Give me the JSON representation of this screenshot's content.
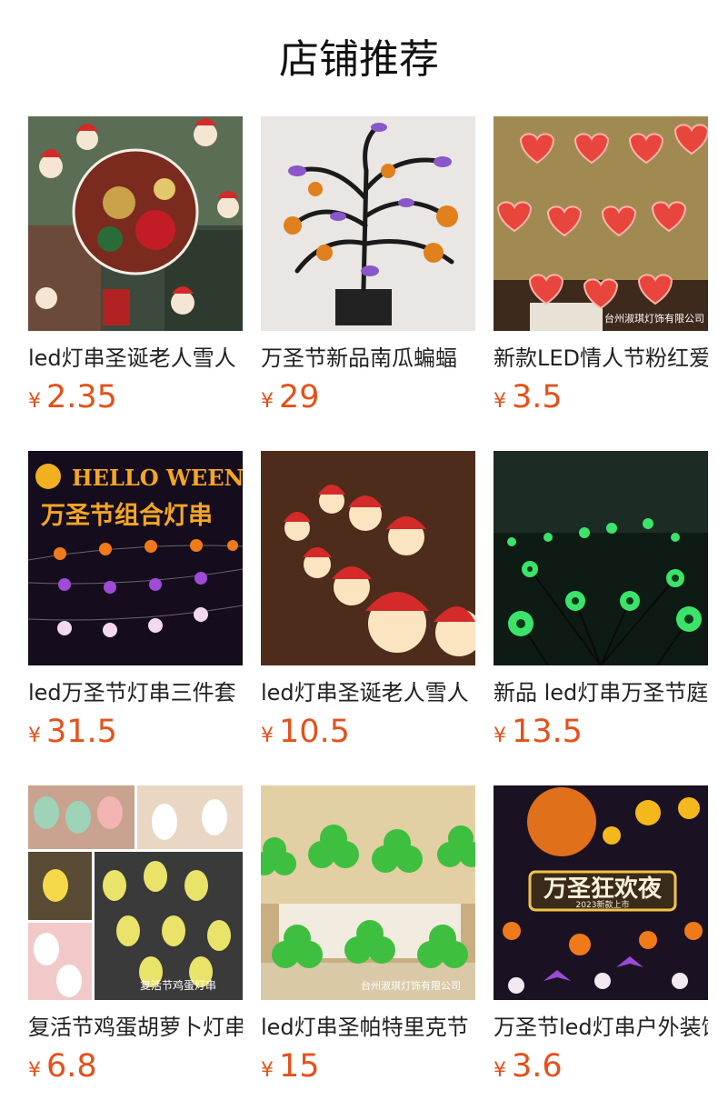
{
  "page": {
    "title": "店铺推荐"
  },
  "products": [
    {
      "name": "led灯串圣诞老人雪人",
      "currency": "¥",
      "price": "2.35",
      "thumb_icon": "christmas-santa-lights-photo"
    },
    {
      "name": "万圣节新品南瓜蝙蝠",
      "currency": "¥",
      "price": "29",
      "thumb_icon": "halloween-tree-lights-photo"
    },
    {
      "name": "新款LED情人节粉红爱心",
      "currency": "¥",
      "price": "3.5",
      "thumb_icon": "heart-lights-photo",
      "watermark": "台州淑琪灯饰有限公司"
    },
    {
      "name": "led万圣节灯串三件套",
      "currency": "¥",
      "price": "31.5",
      "thumb_icon": "halloween-combo-lights-photo",
      "banner_top": "HELLO WEEN",
      "banner_main": "万圣节组合灯串"
    },
    {
      "name": "led灯串圣诞老人雪人",
      "currency": "¥",
      "price": "10.5",
      "thumb_icon": "santa-head-lights-photo"
    },
    {
      "name": "新品 led灯串万圣节庭院",
      "currency": "¥",
      "price": "13.5",
      "thumb_icon": "eyeball-garden-lights-photo"
    },
    {
      "name": "复活节鸡蛋胡萝卜灯串",
      "currency": "¥",
      "price": "6.8",
      "thumb_icon": "easter-egg-lights-photo",
      "watermark": "复活节鸡蛋灯串"
    },
    {
      "name": "led灯串圣帕特里克节",
      "currency": "¥",
      "price": "15",
      "thumb_icon": "shamrock-lights-photo",
      "watermark": "台州淑琪灯饰有限公司"
    },
    {
      "name": "万圣节led灯串户外装饰",
      "currency": "¥",
      "price": "3.6",
      "thumb_icon": "halloween-carnival-lights-photo",
      "banner_main": "万圣狂欢夜",
      "banner_sub": "2023新款上市"
    }
  ]
}
